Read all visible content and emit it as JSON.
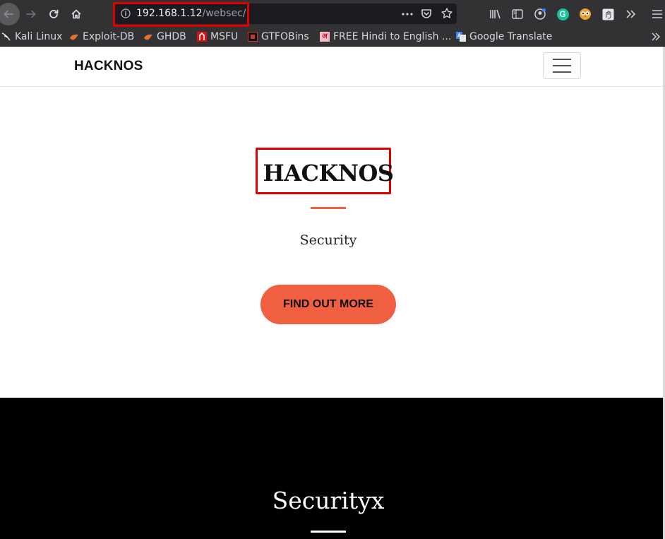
{
  "browser": {
    "url_host": "192.168.1.12",
    "url_path": "/websec/",
    "bookmarks": [
      {
        "label": "Kali Linux",
        "icon": "kali-dragon-icon"
      },
      {
        "label": "Exploit-DB",
        "icon": "exploitdb-icon"
      },
      {
        "label": "GHDB",
        "icon": "ghdb-icon"
      },
      {
        "label": "MSFU",
        "icon": "msfu-icon"
      },
      {
        "label": "GTFOBins",
        "icon": "gtfobins-icon"
      },
      {
        "label": "FREE Hindi to English ...",
        "icon": "hindi-letter-icon"
      },
      {
        "label": "Google Translate",
        "icon": "google-translate-icon"
      }
    ],
    "ext_avatar_letter": "G"
  },
  "site": {
    "brand": "HACKNOS",
    "hero": {
      "title": "HACKNOS",
      "subtitle": "Security",
      "cta_label": "FIND OUT MORE"
    },
    "section": {
      "title": "Securityx"
    }
  },
  "colors": {
    "accent": "#f05f40",
    "highlight": "#e00000",
    "chrome": "#323234"
  }
}
